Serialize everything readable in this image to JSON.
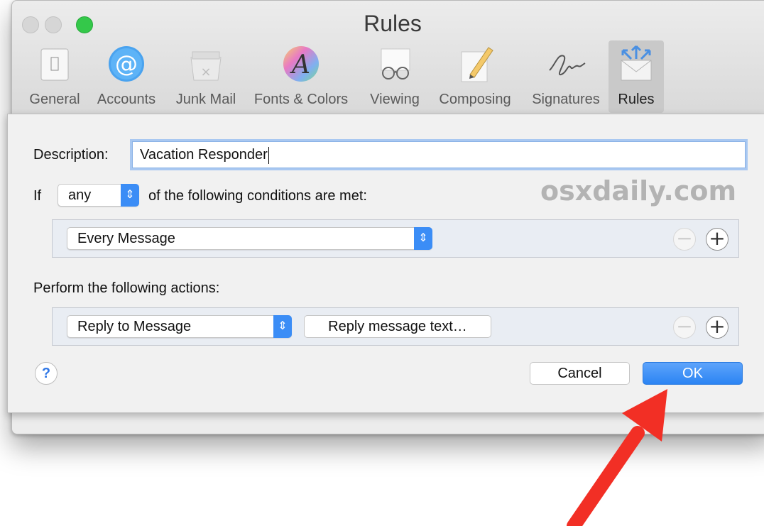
{
  "window": {
    "title": "Rules"
  },
  "toolbar": {
    "items": [
      {
        "label": "General",
        "icon": "general-icon"
      },
      {
        "label": "Accounts",
        "icon": "at-sign-icon"
      },
      {
        "label": "Junk Mail",
        "icon": "junk-mail-icon"
      },
      {
        "label": "Fonts & Colors",
        "icon": "fonts-colors-icon"
      },
      {
        "label": "Viewing",
        "icon": "glasses-icon"
      },
      {
        "label": "Composing",
        "icon": "pencil-icon"
      },
      {
        "label": "Signatures",
        "icon": "signature-icon"
      },
      {
        "label": "Rules",
        "icon": "rules-envelope-icon",
        "selected": true
      }
    ]
  },
  "rule": {
    "description_label": "Description:",
    "description_value": "Vacation Responder",
    "if_label": "If",
    "match_value": "any",
    "conditions_label": "of the following conditions are met:",
    "condition_value": "Every Message",
    "actions_label": "Perform the following actions:",
    "action_value": "Reply to Message",
    "reply_button": "Reply message text…"
  },
  "buttons": {
    "help": "?",
    "cancel": "Cancel",
    "ok": "OK",
    "add": "+",
    "remove": "−"
  },
  "watermark": "osxdaily.com",
  "colors": {
    "accent": "#3b8df6",
    "annotation_arrow": "#f22f25",
    "zoom_light": "#34c84a"
  }
}
